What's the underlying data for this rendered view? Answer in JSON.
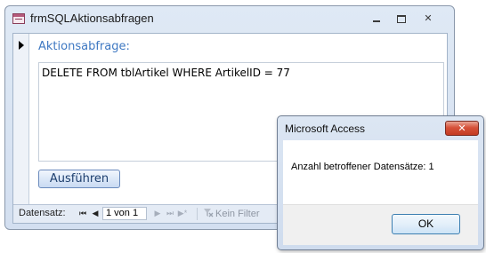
{
  "window": {
    "title": "frmSQLAktionsabfragen",
    "icon": "form-icon"
  },
  "form": {
    "field_label": "Aktionsabfrage:",
    "sql_value": "DELETE FROM tblArtikel WHERE ArtikelID = 77",
    "run_button_label": "Ausführen"
  },
  "navigation": {
    "label": "Datensatz:",
    "first": "⏮",
    "prev": "◀",
    "position": "1 von 1",
    "next": "▶",
    "last": "⏭",
    "new": "▶*",
    "filter_label": "Kein Filter"
  },
  "dialog": {
    "title": "Microsoft Access",
    "close_glyph": "✕",
    "message": "Anzahl betroffener Datensätze: 1",
    "ok_label": "OK"
  },
  "colors": {
    "label_blue": "#3e78c2",
    "close_red": "#c33b22"
  }
}
